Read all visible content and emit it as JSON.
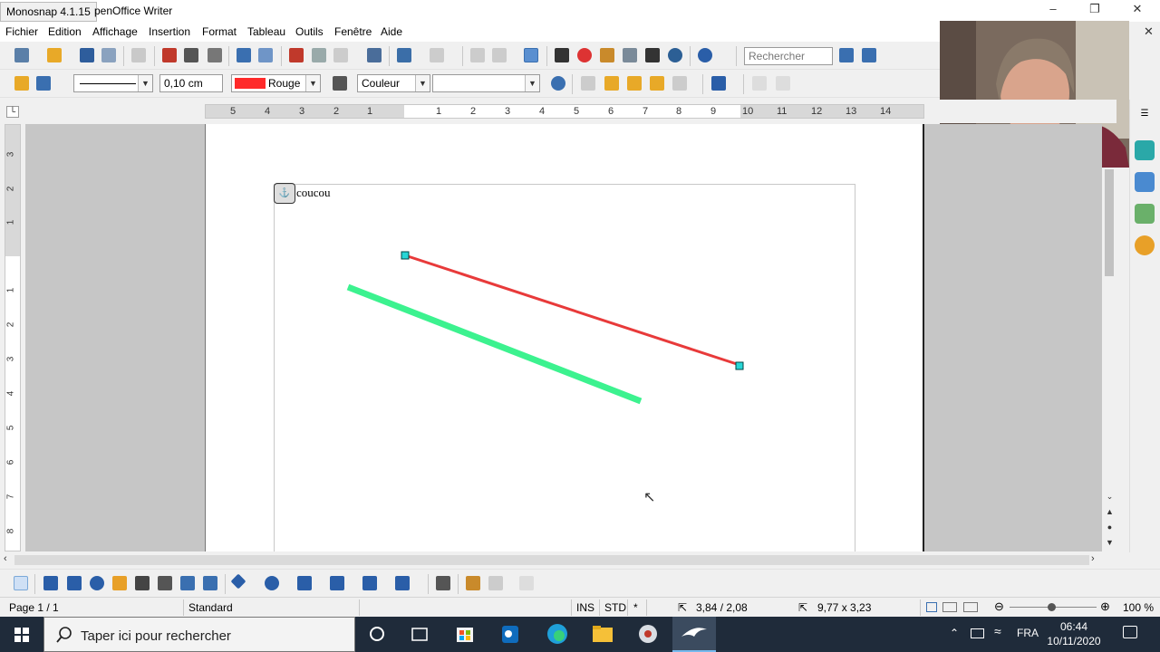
{
  "window": {
    "capture_tool": "Monosnap 4.1.15",
    "title_suffix": "penOffice Writer",
    "minimize": "–",
    "maximize": "❐",
    "close": "✕",
    "close_doc": "✕"
  },
  "menu": [
    "Fichier",
    "Edition",
    "Affichage",
    "Insertion",
    "Format",
    "Tableau",
    "Outils",
    "Fenêtre",
    "Aide"
  ],
  "toolbar1": {
    "search_placeholder": "Rechercher"
  },
  "toolbar2": {
    "line_width": "0,10 cm",
    "line_color_name": "Rouge",
    "line_color_hex": "#ff2a2a",
    "area_style": "Couleur",
    "area_value": ""
  },
  "ruler": {
    "h_left": [
      "5",
      "4",
      "3",
      "2",
      "1"
    ],
    "h_right": [
      "1",
      "2",
      "3",
      "4",
      "5",
      "6",
      "7",
      "8",
      "9",
      "10",
      "11",
      "12",
      "13",
      "14"
    ],
    "v": [
      "3",
      "2",
      "1",
      "1",
      "2",
      "3",
      "4",
      "5",
      "6",
      "7",
      "8"
    ]
  },
  "document": {
    "text": "coucou",
    "red_line_color": "#e83a3a",
    "green_line_color": "#3cf28f",
    "handle_color": "#27d6d6"
  },
  "status": {
    "page": "Page 1 / 1",
    "style": "Standard",
    "ins": "INS",
    "std": "STD",
    "modified": "*",
    "position": "3,84 / 2,08",
    "size": "9,77 x 3,23",
    "zoom": "100 %"
  },
  "taskbar": {
    "search_placeholder": "Taper ici pour rechercher",
    "language": "FRA",
    "time": "06:44",
    "date": "10/11/2020"
  }
}
